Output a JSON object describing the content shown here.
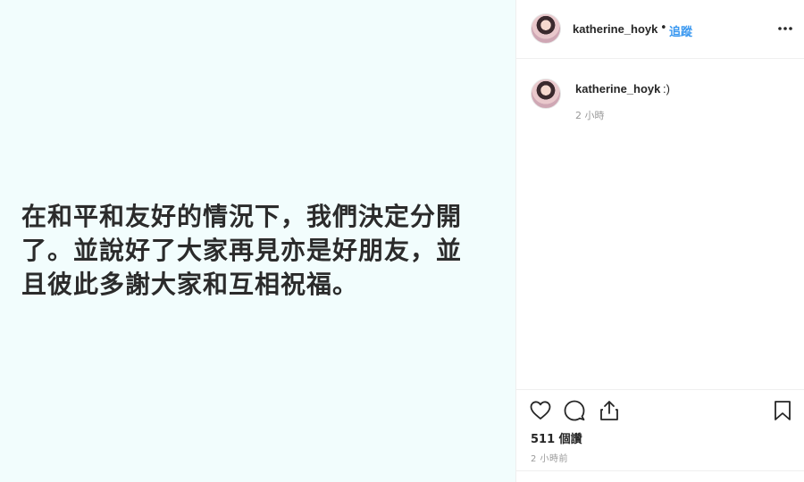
{
  "image": {
    "lines": [
      "在和平和友好的情況下，我們決定分開",
      "了。並說好了大家再見亦是好朋友，並",
      "且彼此多謝大家和互相祝福。"
    ]
  },
  "header": {
    "username": "katherine_hoyk",
    "separator": "•",
    "follow_label": "追蹤",
    "more_icon": "more-options-icon"
  },
  "comment": {
    "username": "katherine_hoyk",
    "text": ":)",
    "time": "2 小時"
  },
  "actions": {
    "icons": [
      "heart-icon",
      "comment-icon",
      "share-icon",
      "bookmark-icon"
    ],
    "likes": "511 個讚",
    "time": "2 小時前"
  },
  "colors": {
    "image_bg": "#f2fdfd",
    "follow": "#3897f0",
    "muted": "#999999"
  }
}
